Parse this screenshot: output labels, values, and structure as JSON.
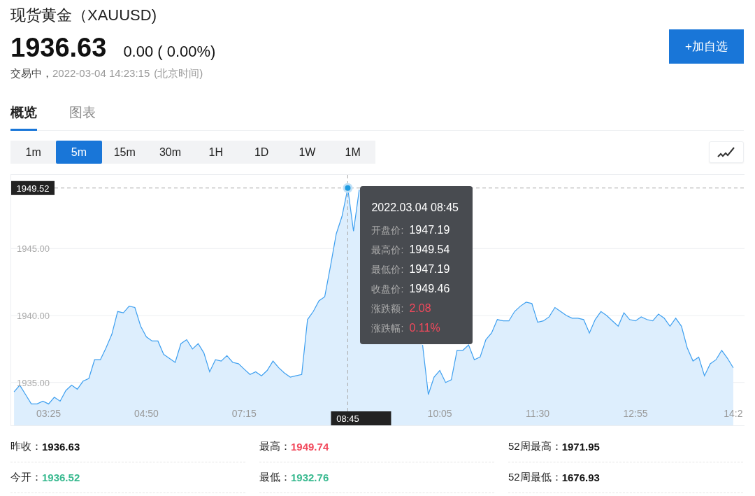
{
  "title": "现货黄金（XAUUSD)",
  "quote": {
    "price": "1936.63",
    "change": "0.00 ( 0.00%)",
    "status": "交易中，",
    "time": "2022-03-04 14:23:15",
    "timezone": "(北京时间)"
  },
  "watch_button": "+加自选",
  "tabs": [
    {
      "label": "概览",
      "selected": true
    },
    {
      "label": "图表",
      "selected": false
    }
  ],
  "periods": [
    {
      "label": "1m",
      "selected": false
    },
    {
      "label": "5m",
      "selected": true
    },
    {
      "label": "15m",
      "selected": false
    },
    {
      "label": "30m",
      "selected": false
    },
    {
      "label": "1H",
      "selected": false
    },
    {
      "label": "1D",
      "selected": false
    },
    {
      "label": "1W",
      "selected": false
    },
    {
      "label": "1M",
      "selected": false
    }
  ],
  "chart": {
    "tooltip": {
      "title": "2022.03.04 08:45",
      "rows": [
        {
          "label": "开盘价:",
          "value": "1947.19",
          "color": "#ffffff"
        },
        {
          "label": "最高价:",
          "value": "1949.54",
          "color": "#ffffff"
        },
        {
          "label": "最低价:",
          "value": "1947.19",
          "color": "#ffffff"
        },
        {
          "label": "收盘价:",
          "value": "1949.46",
          "color": "#ffffff"
        },
        {
          "label": "涨跌额:",
          "value": "2.08",
          "color": "#f2495c"
        },
        {
          "label": "涨跌幅:",
          "value": "0.11%",
          "color": "#f2495c"
        }
      ]
    },
    "chart_data": {
      "type": "area",
      "grid": true,
      "ylim": [
        1931.8,
        1950.5
      ],
      "ref_lines": [
        {
          "axis": "y",
          "value": 1949.52,
          "label": "1949.52"
        }
      ],
      "categories": [
        null,
        null,
        null,
        null,
        null,
        null,
        "03:25",
        null,
        null,
        null,
        null,
        null,
        null,
        null,
        null,
        null,
        null,
        null,
        null,
        null,
        null,
        null,
        null,
        "04:50",
        null,
        null,
        null,
        null,
        null,
        null,
        null,
        null,
        null,
        null,
        null,
        null,
        null,
        null,
        null,
        null,
        "07:15",
        null,
        null,
        null,
        null,
        null,
        null,
        null,
        null,
        null,
        null,
        null,
        null,
        null,
        null,
        null,
        null,
        null,
        "08:45",
        null,
        null,
        null,
        null,
        null,
        null,
        null,
        null,
        null,
        null,
        null,
        null,
        null,
        null,
        null,
        "10:05",
        null,
        null,
        null,
        null,
        null,
        null,
        null,
        null,
        null,
        null,
        null,
        null,
        null,
        null,
        null,
        null,
        "11:30",
        null,
        null,
        null,
        null,
        null,
        null,
        null,
        null,
        null,
        null,
        null,
        null,
        null,
        null,
        null,
        null,
        "12:55",
        null,
        null,
        null,
        null,
        null,
        null,
        null,
        null,
        null,
        null,
        null,
        null,
        null,
        null,
        null,
        null,
        "14:2"
      ],
      "yticks": [
        {
          "value": 1935,
          "label": "1935.00"
        },
        {
          "value": 1940,
          "label": "1940.00"
        },
        {
          "value": 1945,
          "label": "1945.00"
        }
      ],
      "series": [
        {
          "color": "#3d9ff0",
          "values": [
            1934.3,
            1934.8,
            1934.1,
            1933.4,
            1933.4,
            1933.6,
            1933.4,
            1933.9,
            1933.6,
            1934.4,
            1934.8,
            1934.5,
            1935.1,
            1935.3,
            1936.7,
            1936.7,
            1937.6,
            1938.6,
            1940.3,
            1940.2,
            1940.7,
            1940.6,
            1939.2,
            1938.4,
            1938.1,
            1938.1,
            1937.1,
            1936.8,
            1936.5,
            1937.9,
            1938.2,
            1937.5,
            1937.9,
            1937.2,
            1935.8,
            1936.7,
            1936.6,
            1937.0,
            1936.5,
            1936.4,
            1936.0,
            1935.6,
            1935.8,
            1935.5,
            1935.9,
            1936.6,
            1936.1,
            1935.7,
            1935.4,
            1935.5,
            1935.6,
            1939.7,
            1940.3,
            1941.1,
            1941.4,
            1943.7,
            1946.1,
            1947.4,
            1949.5,
            1946.3,
            1949.4,
            null,
            null,
            null,
            null,
            null,
            null,
            null,
            null,
            null,
            null,
            1937.8,
            1934.1,
            1935.4,
            1935.9,
            1935.0,
            1935.2,
            1937.4,
            1937.4,
            1937.8,
            1936.7,
            1936.9,
            1938.2,
            1938.7,
            1939.7,
            1939.6,
            1939.6,
            1940.3,
            1940.7,
            1941.0,
            1940.9,
            1939.5,
            1939.6,
            1939.9,
            1940.6,
            1940.3,
            1940.0,
            1939.8,
            1939.8,
            1939.7,
            1938.7,
            1939.7,
            1940.3,
            1940.0,
            1939.6,
            1939.2,
            1940.2,
            1939.7,
            1939.6,
            1939.9,
            1939.7,
            1939.6,
            1940.1,
            1939.8,
            1939.2,
            1939.8,
            1939.2,
            1937.6,
            1936.6,
            1936.9,
            1935.5,
            1936.4,
            1936.7,
            1937.4,
            1936.8,
            1936.1
          ]
        }
      ]
    }
  },
  "stats": [
    {
      "label": "昨收：",
      "value": "1936.63",
      "color": "#111111"
    },
    {
      "label": "最高：",
      "value": "1949.74",
      "color": "#f2495c"
    },
    {
      "label": "52周最高：",
      "value": "1971.95",
      "color": "#111111"
    },
    {
      "label": "今开：",
      "value": "1936.52",
      "color": "#38b98f"
    },
    {
      "label": "最低：",
      "value": "1932.76",
      "color": "#38b98f"
    },
    {
      "label": "52周最低：",
      "value": "1676.93",
      "color": "#111111"
    }
  ]
}
